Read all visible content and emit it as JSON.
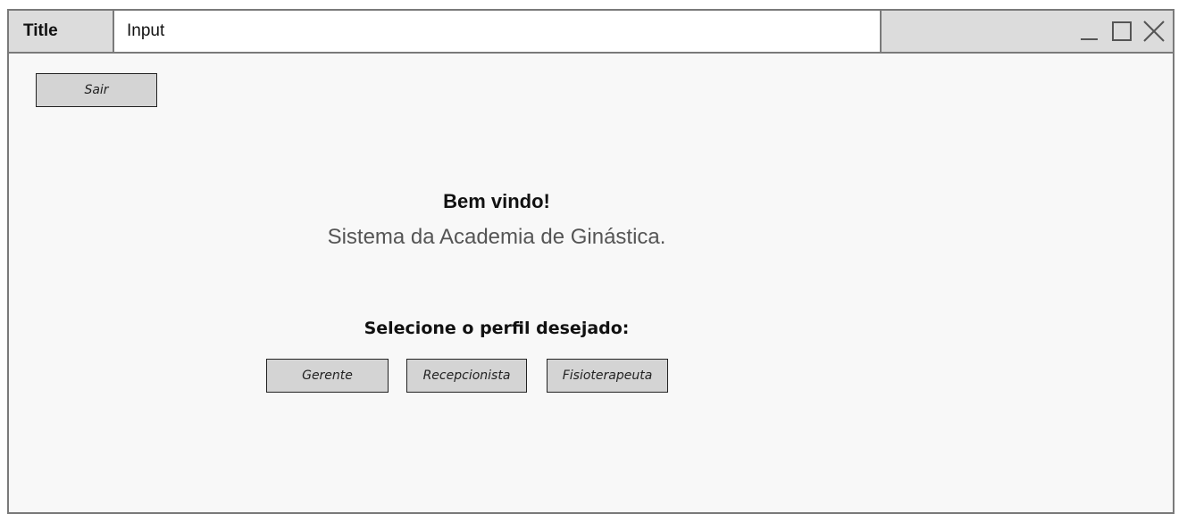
{
  "window": {
    "title": "Title",
    "input": "Input",
    "controls": {
      "minimize_icon": "minimize-icon",
      "maximize_icon": "maximize-icon",
      "close_icon": "close-icon"
    }
  },
  "toolbar": {
    "sair_label": "Sair"
  },
  "main": {
    "welcome": "Bem vindo!",
    "subtitle": "Sistema da Academia de Ginástica.",
    "select_label": "Selecione o perfil desejado:",
    "profiles": [
      {
        "label": "Gerente"
      },
      {
        "label": "Recepcionista"
      },
      {
        "label": "Fisioterapeuta"
      }
    ]
  },
  "colors": {
    "window_border": "#7a7a7a",
    "titlebar_bg": "#dcdcdc",
    "content_bg": "#f8f8f8",
    "button_bg": "#d4d4d4"
  }
}
